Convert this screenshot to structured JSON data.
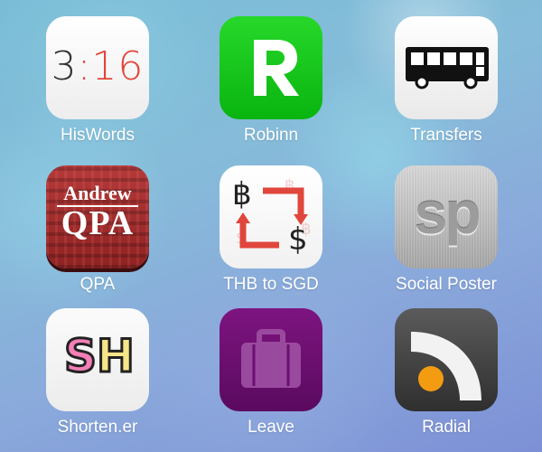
{
  "apps": [
    {
      "label": "HisWords"
    },
    {
      "label": "Robinn",
      "glyph": "R"
    },
    {
      "label": "Transfers"
    },
    {
      "label": "QPA",
      "glyph_line1": "Andrew",
      "glyph_line2": "QPA"
    },
    {
      "label": "THB to SGD",
      "glyph_from": "฿",
      "glyph_to": "$"
    },
    {
      "label": "Social Poster",
      "glyph": "sp"
    },
    {
      "label": "Shorten.er",
      "glyph_s": "S",
      "glyph_h": "H"
    },
    {
      "label": "Leave"
    },
    {
      "label": "Radial"
    }
  ],
  "clock": {
    "hour": "3",
    "minutes": ":16"
  },
  "icons": {
    "hiswords": "clock-icon",
    "robinn": "letter-r-icon",
    "transfers": "bus-icon",
    "qpa": "tartan-logo-icon",
    "thb": "currency-exchange-icon",
    "social_poster": "sp-logo-icon",
    "shorten": "sh-logo-icon",
    "leave": "suitcase-icon",
    "radial": "rss-feed-icon"
  },
  "colors": {
    "robinn_green": "#16c51a",
    "clock_red": "#e2453b",
    "leave_purple": "#6b0f70",
    "radial_orange": "#f39c12"
  }
}
